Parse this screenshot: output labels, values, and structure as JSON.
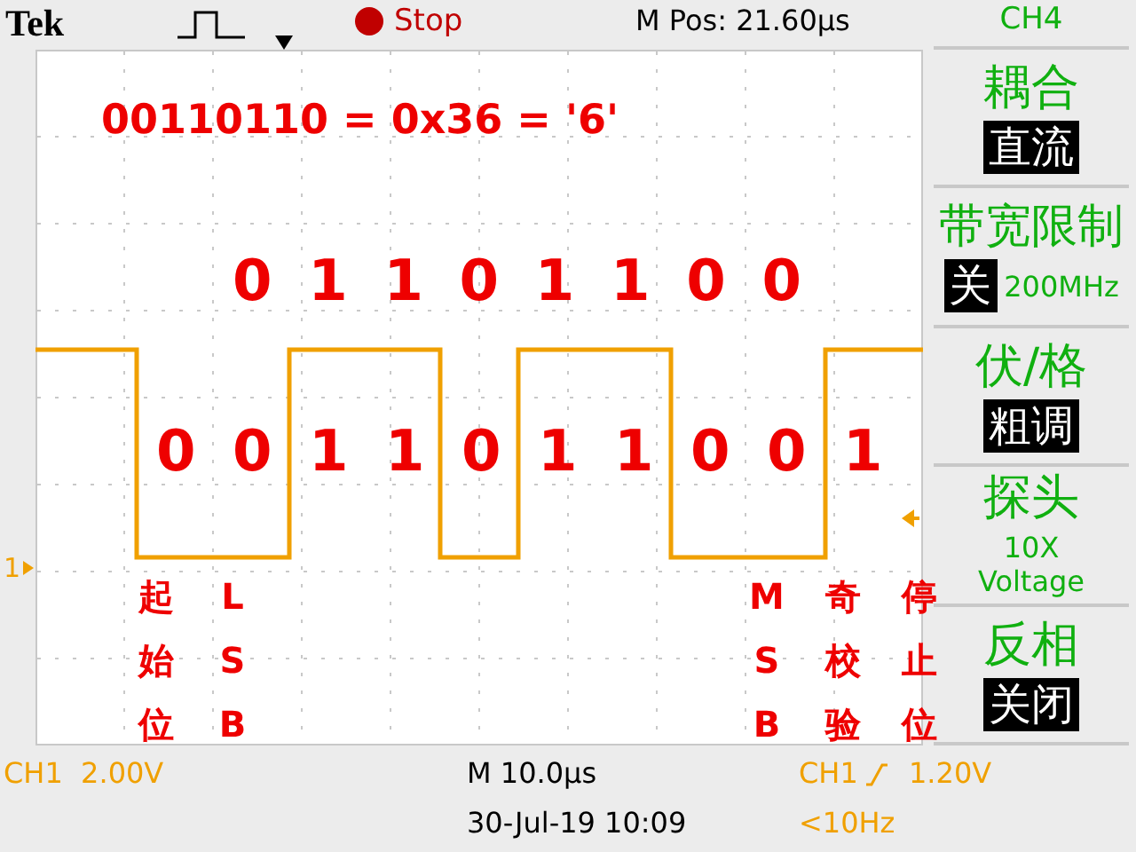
{
  "header": {
    "brand": "Tek",
    "state": "Stop",
    "position": "M Pos: 21.60µs"
  },
  "annotation": {
    "title": "00110110 = 0x36 = '6'",
    "upper_bits": [
      "0",
      "1",
      "1",
      "0",
      "1",
      "1",
      "0",
      "0"
    ],
    "lower_bits": [
      "0",
      "0",
      "1",
      "1",
      "0",
      "1",
      "1",
      "0",
      "0",
      "1"
    ],
    "columns": [
      "起始位",
      "LSB",
      "MSB",
      "奇校验",
      "停止位"
    ]
  },
  "channel_marker": "1",
  "menu": {
    "title": "CH4",
    "items": [
      {
        "label": "耦合",
        "values": [
          {
            "text": "直流",
            "boxed": true
          }
        ]
      },
      {
        "label": "带宽限制",
        "values": [
          {
            "text": "关",
            "boxed": true
          },
          {
            "text": "200MHz",
            "boxed": false
          }
        ]
      },
      {
        "label": "伏/格",
        "values": [
          {
            "text": "粗调",
            "boxed": true
          }
        ]
      },
      {
        "label": "探头",
        "values": [
          {
            "text": "10X",
            "boxed": false
          },
          {
            "text": "Voltage",
            "boxed": false
          }
        ]
      },
      {
        "label": "反相",
        "values": [
          {
            "text": "关闭",
            "boxed": true
          }
        ]
      }
    ]
  },
  "footer": {
    "scale": "CH1  2.00V",
    "timebase": "M 10.0µs",
    "date": "30-Jul-19 10:09",
    "trigger_source": "CH1",
    "trigger_level": "1.20V",
    "frequency": "<10Hz"
  }
}
